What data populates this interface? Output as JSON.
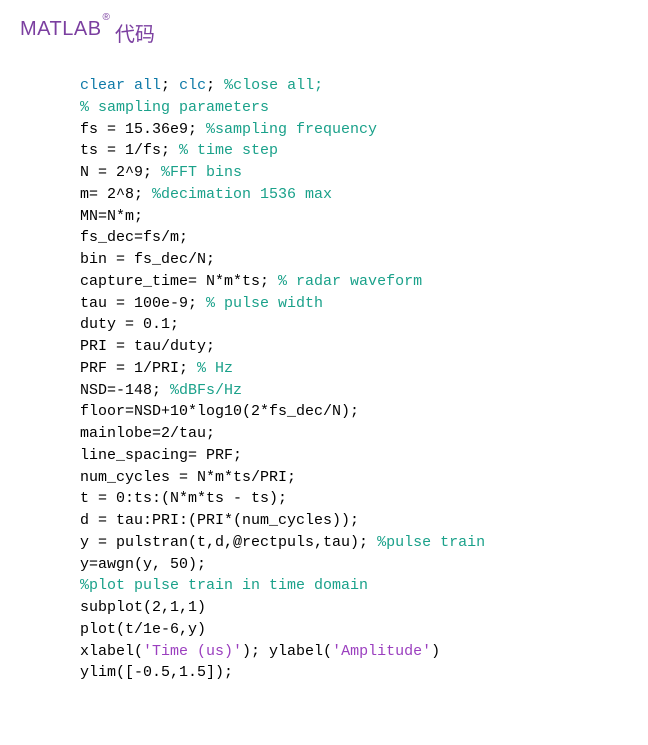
{
  "title": {
    "brand": "MATLAB",
    "reg": "®",
    "suffix": "代码"
  },
  "tok": {
    "clear": "clear",
    "all": "all",
    "clc": "clc",
    "cm_close_all": "%close all;",
    "cm_samp": "% sampling parameters",
    "cm_sf": "%sampling frequency",
    "cm_ts": "% time step",
    "cm_fft": "%FFT bins",
    "cm_dec": "%decimation 1536 max",
    "cm_rw": "% radar waveform",
    "cm_pw": "% pulse width",
    "cm_hz": "% Hz",
    "cm_dbfs": "%dBFs/Hz",
    "cm_pt": "%pulse train",
    "cm_pptd": "%plot pulse train in time domain",
    "str_time": "'Time (us)'",
    "str_amp": "'Amplitude'",
    "l3": "fs = 15.36e9; ",
    "l4": "ts = 1/fs; ",
    "l5": "N = 2^9; ",
    "l6": "m= 2^8; ",
    "l7": "MN=N*m;",
    "l8": "fs_dec=fs/m;",
    "l9": "bin = fs_dec/N;",
    "l10": "capture_time= N*m*ts; ",
    "l11": "tau = 100e-9; ",
    "l12": "duty = 0.1;",
    "l13": "PRI = tau/duty;",
    "l14": "PRF = 1/PRI; ",
    "l15": "NSD=-148; ",
    "l16": "floor=NSD+10*log10(2*fs_dec/N);",
    "l17": "mainlobe=2/tau;",
    "l18": "line_spacing= PRF;",
    "l19": "num_cycles = N*m*ts/PRI;",
    "l20": "t = 0:ts:(N*m*ts - ts);",
    "l21": "d = tau:PRI:(PRI*(num_cycles));",
    "l22": "y = pulstran(t,d,@rectpuls,tau); ",
    "l23": "y=awgn(y, 50);",
    "l25": "subplot(2,1,1)",
    "l26": "plot(t/1e-6,y)",
    "l27a": "xlabel(",
    "l27b": "); ylabel(",
    "l27c": ")",
    "l28": "ylim([-0.5,1.5]);"
  }
}
